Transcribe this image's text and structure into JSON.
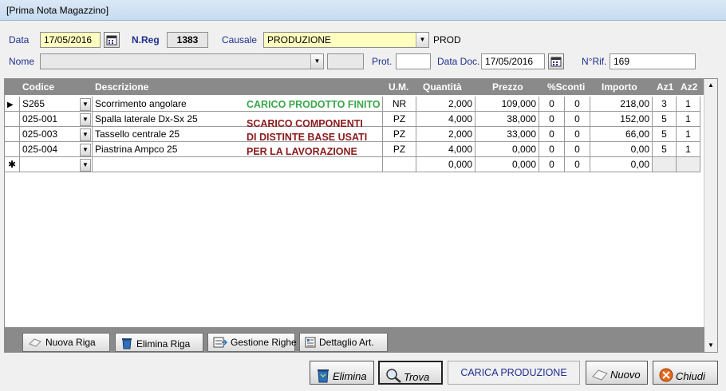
{
  "window": {
    "title": "[Prima Nota Magazzino]"
  },
  "header": {
    "data_label": "Data",
    "data_value": "17/05/2016",
    "nreg_label": "N.Reg",
    "nreg_value": "1383",
    "causale_label": "Causale",
    "causale_value": "PRODUZIONE",
    "causale_code": "PROD",
    "nome_label": "Nome",
    "nome_value": "",
    "prot_label": "Prot.",
    "prot_value": "",
    "datadoc_label": "Data Doc.",
    "datadoc_value": "17/05/2016",
    "nrif_label": "N°Rif.",
    "nrif_value": "169"
  },
  "grid": {
    "columns": [
      "Codice",
      "Descrizione",
      "U.M.",
      "Quantità",
      "Prezzo",
      "%Sconti",
      "Importo",
      "Az1",
      "Az2"
    ],
    "rows": [
      {
        "codice": "S265",
        "descrizione": "Scorrimento angolare",
        "um": "NR",
        "quantita": "2,000",
        "prezzo": "109,000",
        "sc1": "0",
        "sc2": "0",
        "importo": "218,00",
        "az1": "3",
        "az2": "1"
      },
      {
        "codice": "025-001",
        "descrizione": "Spalla laterale Dx-Sx 25",
        "um": "PZ",
        "quantita": "4,000",
        "prezzo": "38,000",
        "sc1": "0",
        "sc2": "0",
        "importo": "152,00",
        "az1": "5",
        "az2": "1"
      },
      {
        "codice": "025-003",
        "descrizione": "Tassello centrale 25",
        "um": "PZ",
        "quantita": "2,000",
        "prezzo": "33,000",
        "sc1": "0",
        "sc2": "0",
        "importo": "66,00",
        "az1": "5",
        "az2": "1"
      },
      {
        "codice": "025-004",
        "descrizione": "Piastrina Ampco 25",
        "um": "PZ",
        "quantita": "4,000",
        "prezzo": "0,000",
        "sc1": "0",
        "sc2": "0",
        "importo": "0,00",
        "az1": "5",
        "az2": "1"
      }
    ],
    "new_row": {
      "marker": "✱",
      "quantita": "0,000",
      "prezzo": "0,000",
      "sc1": "0",
      "sc2": "0",
      "importo": "0,00"
    },
    "annotations": {
      "carico": "CARICO PRODOTTO FINITO",
      "scarico_1": "SCARICO COMPONENTI",
      "scarico_2": "DI DISTINTE BASE USATI",
      "scarico_3": "PER LA LAVORAZIONE",
      "carico_color": "#3aa64a",
      "scarico_color": "#8b1a1a"
    }
  },
  "row_buttons": {
    "nuova_riga": "Nuova Riga",
    "elimina_riga": "Elimina Riga",
    "gestione_righe": "Gestione Righe",
    "dettaglio_art": "Dettaglio Art."
  },
  "bottom_buttons": {
    "elimina": "Elimina",
    "trova": "Trova",
    "carica_produzione": "CARICA PRODUZIONE",
    "nuovo": "Nuovo",
    "chiudi": "Chiudi"
  },
  "colors": {
    "label_blue": "#1f2f8f",
    "yellow_field": "#ffffc0",
    "grid_header": "#8a8a8a"
  }
}
